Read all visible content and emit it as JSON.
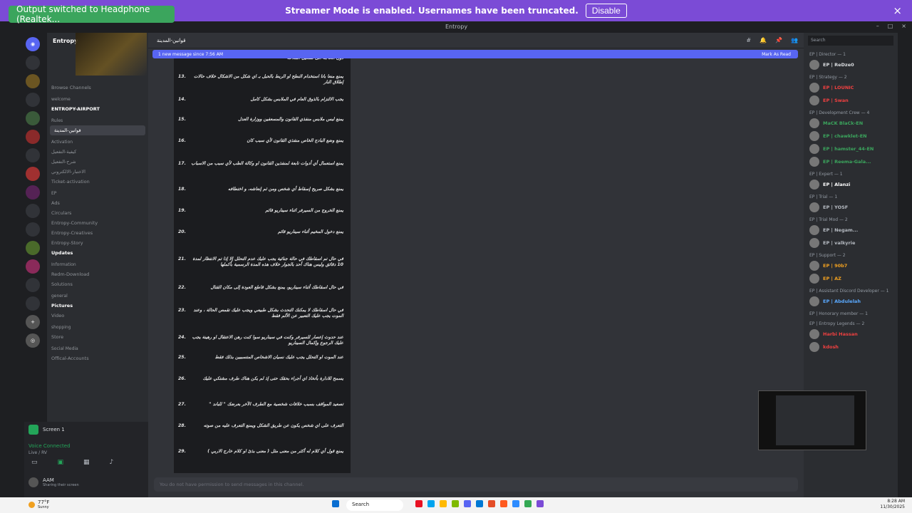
{
  "overlay": {
    "toast": "Output switched to Headphone (Realtek...",
    "banner_text": "Streamer Mode is enabled. Usernames have been truncated.",
    "disable_label": "Disable",
    "close_icon": "×"
  },
  "window": {
    "title": "Entropy",
    "controls": [
      "–",
      "□",
      "×"
    ]
  },
  "server": {
    "name": "Entropy",
    "browse": "Browse Channels",
    "categories": [
      {
        "label": "welcome",
        "channels": [
          {
            "name": "ENTROPY-AIRPORT",
            "state": "unread"
          }
        ]
      },
      {
        "label": "Rules",
        "channels": [
          {
            "name": "قوانين-المدينة",
            "state": "active"
          }
        ]
      },
      {
        "label": "Activation",
        "channels": [
          {
            "name": "كيفية-التفعيل",
            "state": ""
          },
          {
            "name": "شرح-التفعيل",
            "state": ""
          },
          {
            "name": "الاختبار-الالكتروني",
            "state": ""
          },
          {
            "name": "Ticket-activation",
            "state": ""
          }
        ]
      },
      {
        "label": "EP",
        "channels": [
          {
            "name": "Ads",
            "state": ""
          },
          {
            "name": "Circulars",
            "state": ""
          },
          {
            "name": "Entropy-Community",
            "state": ""
          },
          {
            "name": "Entropy-Creatives",
            "state": ""
          },
          {
            "name": "Entropy-Story",
            "state": ""
          },
          {
            "name": "Updates",
            "state": "unread"
          }
        ]
      },
      {
        "label": "Information",
        "channels": [
          {
            "name": "Redm-Download",
            "state": ""
          },
          {
            "name": "Solutions",
            "state": ""
          }
        ]
      },
      {
        "label": "general",
        "channels": [
          {
            "name": "Pictures",
            "state": "unread"
          },
          {
            "name": "Video",
            "state": ""
          }
        ]
      },
      {
        "label": "shopping",
        "channels": [
          {
            "name": "Store",
            "state": ""
          }
        ]
      },
      {
        "label": "Social Media",
        "channels": [
          {
            "name": "Offical-Accounts",
            "state": ""
          }
        ]
      }
    ]
  },
  "user_panel": {
    "screen_label": "Screen 1",
    "voice_label": "Voice Connected",
    "voice_sub": "Live / RV",
    "username": "AAM",
    "user_status": "Sharing their screen"
  },
  "channel": {
    "name": "قوانين-المدينة",
    "new_message": "1 new message since 7:56 AM",
    "mark_read": "Mark As Read",
    "composer": "You do not have permission to send messages in this channel."
  },
  "rules": [
    {
      "n": "",
      "t": "دون الحاجة الى تشغيل الملاحة"
    },
    {
      "n": "13.",
      "t": "يمنع منعا باتا استخدام النطح او الربط بالحبل بـ اي شكل من الاشكال خلاف حالات إطلاق النار"
    },
    {
      "n": "14.",
      "t": "يجب الالتزام بالذوق العام في الملابس بشكل كامل"
    },
    {
      "n": "15.",
      "t": "يمنع لبس ملابس منفذي القانون والمسعفين ووزارة العدل"
    },
    {
      "n": "16.",
      "t": "يمنع وضع البادج الخاص منفذي القانون لأي سبب كان"
    },
    {
      "n": "17.",
      "t": "يمنع استعمال أي أدوات تابعة لمنفذين القانون او وكالة الطب لأي سبب من الاسباب"
    },
    {
      "n": "18.",
      "t": "يمنع بشكل صريح إسقاط أي شخص ومن ثم إنعاشه، و اختطافه"
    },
    {
      "n": "19.",
      "t": "يمنع الخروج من السيرفر اثناء سيناريو قائم"
    },
    {
      "n": "20.",
      "t": "يمنع دخول المخيم أثناء سيناريو قائم"
    },
    {
      "n": "21.",
      "t": "في حال تم اسقاطك في حالة جنائية يجب عليك عدم التحلل إلا إذا تم الانتظار لمدة 10 دقائق وليس هناك أحد بالجوار خلاف هذه المدة الرسمية بأكملها"
    },
    {
      "n": "22.",
      "t": "في حال اسقاطك أثناء سيناريو، يمنع بشكل قاطع العودة إلى مكان القتال"
    },
    {
      "n": "23.",
      "t": "في حال اسقاطك لا يمكنك التحدث بشكل طبيعي ويجب عليك تقمص الحالة ، وعند الموت يجب عليك التعبير عن الألم فقط"
    },
    {
      "n": "24.",
      "t": "عند حدوث إعصار للسيرفر وكنت في سيناريو سوا كنت رهن الاعتقال او رهينة يجب عليك الرجوع وإكمال السيناريو"
    },
    {
      "n": "25.",
      "t": "عند الموت او التحلل يجب عليك نسيان الاشخاص المتسببين بذلك فقط"
    },
    {
      "n": "26.",
      "t": "يسمح للادارة بأتخاذ اي أجراء بحقك حتى إذ لم يكن هناك طرف مشتكي عليك"
    },
    {
      "n": "27.",
      "t": "تصعيد المواقف بسبب خلافات شخصية مع الطرف الآخر بعرضك \" للباند \""
    },
    {
      "n": "28.",
      "t": "التعرف على اي شخص يكون عن طريق الشكل ويمنع التعرف عليه من صوته"
    },
    {
      "n": "29.",
      "t": "يمنع قول أي كلام له أكثر من معنى مثل ( معنى بذئ او كلام خارج الاربي )"
    }
  ],
  "members": {
    "search_placeholder": "Search",
    "sections": [
      {
        "label": "EP | Director — 1",
        "items": [
          {
            "name": "EP | ReDze0",
            "color": "#dbdee1"
          }
        ]
      },
      {
        "label": "EP | Strategy — 2",
        "items": [
          {
            "name": "EP | LOUNIC",
            "color": "#f04040"
          },
          {
            "name": "EP | Swan",
            "color": "#f04040"
          }
        ]
      },
      {
        "label": "EP | Development Crew — 4",
        "items": [
          {
            "name": "MaCK BlaCk-EN",
            "color": "#3ba55d"
          },
          {
            "name": "EP | chawklet-EN",
            "color": "#3ba55d"
          },
          {
            "name": "EP | hamster_44-EN",
            "color": "#3ba55d"
          },
          {
            "name": "EP | Reema-Gala...",
            "color": "#3ba55d"
          }
        ]
      },
      {
        "label": "EP | Expert — 1",
        "items": [
          {
            "name": "EP | Alanzi",
            "color": "#ffffff"
          }
        ]
      },
      {
        "label": "EP | Trial — 1",
        "items": [
          {
            "name": "EP | YOSF",
            "color": "#b5bac1"
          }
        ]
      },
      {
        "label": "EP | Trial Mod — 2",
        "items": [
          {
            "name": "EP | Negam...",
            "color": "#b5bac1"
          },
          {
            "name": "EP | valkyrie",
            "color": "#b5bac1"
          }
        ]
      },
      {
        "label": "EP | Support — 2",
        "items": [
          {
            "name": "EP | 90b7",
            "color": "#f0a020"
          },
          {
            "name": "EP | AZ",
            "color": "#f0a020"
          }
        ]
      },
      {
        "label": "EP | Assistant Discord Developer — 1",
        "items": [
          {
            "name": "EP | Abdulelah",
            "color": "#5aa9ff"
          }
        ]
      },
      {
        "label": "EP | Honorary member — 1",
        "items": []
      },
      {
        "label": "EP | Entropy Legends — 2",
        "items": [
          {
            "name": "Harbi Hassan",
            "color": "#f04040"
          },
          {
            "name": "kdosh",
            "color": "#f04040"
          }
        ]
      }
    ]
  },
  "taskbar": {
    "weather": "77°F",
    "weather_sub": "Sunny",
    "search": "Search",
    "time": "8:28 AM",
    "date": "11/30/2025",
    "app_colors": [
      "#0a6ed1",
      "#e81123",
      "#00a4ef",
      "#ffb900",
      "#7fba00",
      "#5865f2",
      "#0078d4",
      "#e44d26",
      "#ff5a1f",
      "#2d8cff",
      "#34a853",
      "#7b4bd6"
    ]
  }
}
